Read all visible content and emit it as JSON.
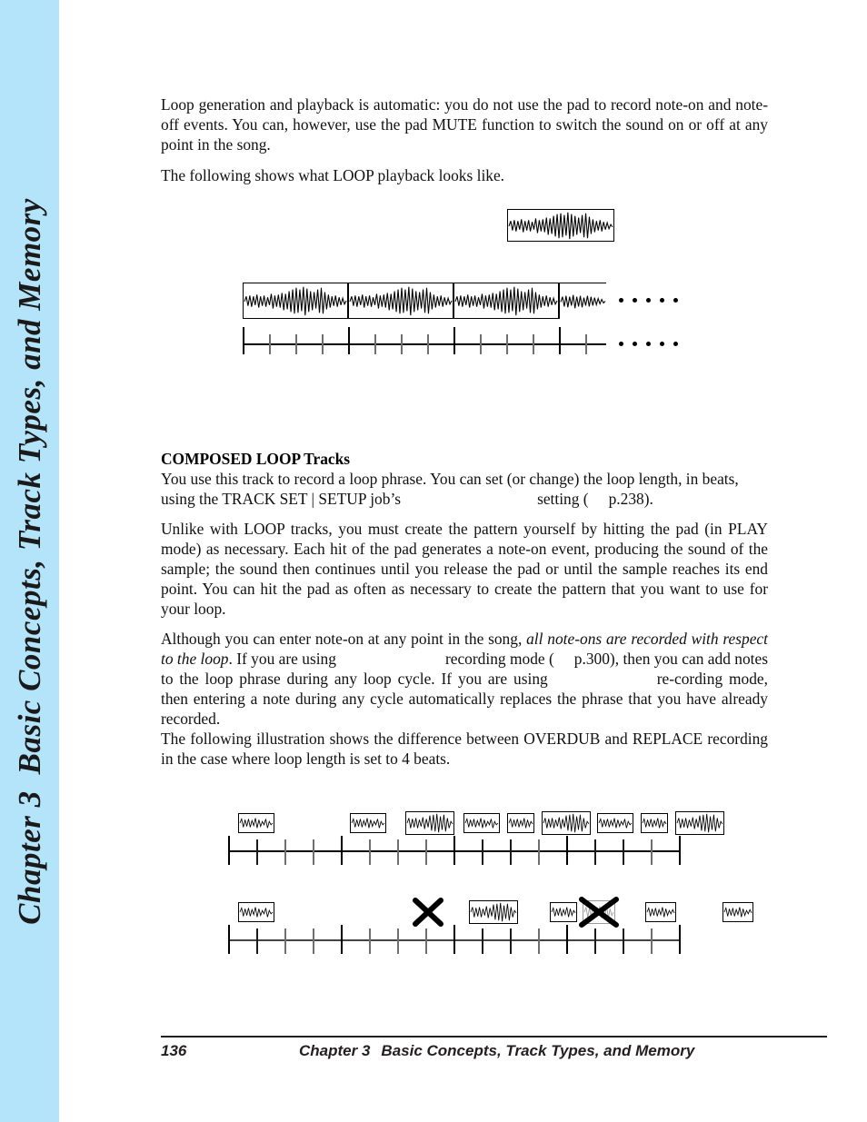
{
  "chapter_tab": {
    "number_label": "Chapter 3",
    "title": "Basic Concepts, Track Types, and Memory",
    "background_color": "#b4e4f9"
  },
  "body": {
    "paragraph_1": "Loop generation and playback is automatic: you do not use the pad to record note-on and note-off events. You can, however, use the pad MUTE function to switch the sound on or off at any point in the song.",
    "paragraph_2": "The following shows what LOOP playback looks like.",
    "section_heading": "COMPOSED LOOP Tracks",
    "paragraph_3_part_a": "You use this track to record a loop phrase. You can set (or change) the loop length, in beats, using the TRACK SET | SETUP job’s",
    "paragraph_3_part_b": "setting (",
    "paragraph_3_part_c": "p.238).",
    "paragraph_4": "Unlike with LOOP tracks, you must create the pattern yourself by hitting the pad (in PLAY mode) as necessary. Each hit of the pad generates a note-on event, producing the sound of the sample; the sound then continues until you release the pad or until the sample reaches its end point. You can hit the pad as often as necessary to create the pattern that you want to use for your loop.",
    "paragraph_5_part_a": "Although you can enter note-on at any point in the song,",
    "paragraph_5_italic_a": "all note-ons are recorded with respect to the loop",
    "paragraph_5_part_b": ". If you are using",
    "paragraph_5_part_c": "recording mode (",
    "paragraph_5_part_d": "p.300), then you can add notes to the loop phrase during any loop cycle. If you are using",
    "paragraph_5_part_e": "re-cording mode, then entering a note during any cycle automatically replaces the phrase that you have already recorded.",
    "paragraph_6": "The following illustration shows the difference between OVERDUB and REPLACE recording in the case where loop length is set to 4 beats."
  },
  "figures": {
    "loop_playback": {
      "sample_box_label": "sample-waveform",
      "cycles": 3,
      "partial_cycle": true,
      "beats_per_cycle": 4,
      "continuation_dots": 5
    },
    "overdub": {
      "label": "overdub-timeline",
      "beats_per_bar": 4,
      "bars": 4,
      "continuation_dots": 0,
      "events": [
        {
          "beat": 1,
          "kind": "note",
          "crossed": false
        },
        {
          "beat": 5,
          "kind": "note",
          "crossed": false
        },
        {
          "beat": 7,
          "kind": "note",
          "crossed": false
        },
        {
          "beat": 9,
          "kind": "note",
          "crossed": false
        },
        {
          "beat": 10,
          "kind": "note",
          "crossed": false
        },
        {
          "beat": 11,
          "kind": "note",
          "crossed": false
        },
        {
          "beat": 13,
          "kind": "note",
          "crossed": false
        },
        {
          "beat": 14,
          "kind": "note",
          "crossed": false
        },
        {
          "beat": 15,
          "kind": "note",
          "crossed": false
        }
      ]
    },
    "replace": {
      "label": "replace-timeline",
      "beats_per_bar": 4,
      "bars": 4,
      "continuation_dots": 0,
      "events": [
        {
          "beat": 1,
          "kind": "note",
          "crossed": false
        },
        {
          "beat": 5,
          "kind": "cross-only",
          "crossed": true
        },
        {
          "beat": 7,
          "kind": "note",
          "crossed": false
        },
        {
          "beat": 10,
          "kind": "note",
          "crossed": false
        },
        {
          "beat": 11,
          "kind": "note",
          "crossed": true
        },
        {
          "beat": 13,
          "kind": "note",
          "crossed": false
        },
        {
          "beat": 16,
          "kind": "note",
          "crossed": false
        }
      ]
    }
  },
  "footer": {
    "page_number": "136",
    "chapter_number": "Chapter 3",
    "chapter_title": "Basic Concepts, Track Types, and Memory"
  }
}
